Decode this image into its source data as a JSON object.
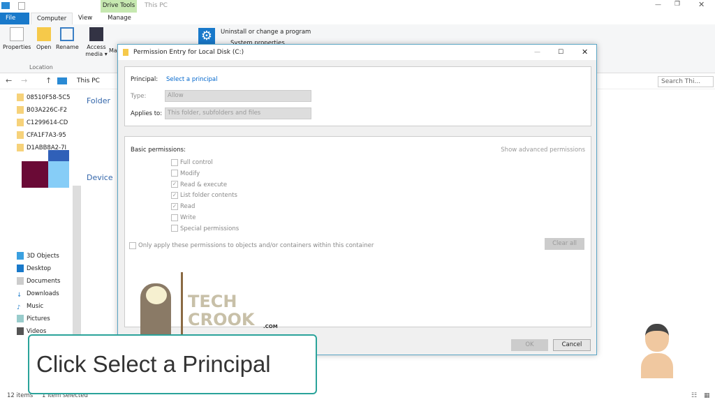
{
  "window": {
    "title": "This PC",
    "context_tab": "Drive Tools"
  },
  "tabs": [
    {
      "label": "File"
    },
    {
      "label": "Computer"
    },
    {
      "label": "View"
    },
    {
      "label": "Manage"
    }
  ],
  "ribbon": {
    "buttons": [
      {
        "label": "Properties"
      },
      {
        "label": "Open"
      },
      {
        "label": "Rename"
      },
      {
        "label": "Access media ▾"
      },
      {
        "label": "Ma"
      }
    ],
    "group_label": "Location",
    "links": [
      {
        "label": "Uninstall or change a program"
      },
      {
        "label": "System properties"
      }
    ]
  },
  "address": {
    "path": "This PC",
    "search_placeholder": "Search Thi..."
  },
  "nav": {
    "pinned": [
      {
        "label": "08510F58-5C5"
      },
      {
        "label": "B03A226C-F2"
      },
      {
        "label": "C1299614-CD"
      },
      {
        "label": "CFA1F7A3-95"
      },
      {
        "label": "D1ABB8A2-7I"
      }
    ],
    "items": [
      {
        "label": "3D Objects"
      },
      {
        "label": "Desktop"
      },
      {
        "label": "Documents"
      },
      {
        "label": "Downloads"
      },
      {
        "label": "Music"
      },
      {
        "label": "Pictures"
      },
      {
        "label": "Videos"
      }
    ]
  },
  "content": {
    "sections": [
      {
        "label": "Folder"
      },
      {
        "label": "Device"
      }
    ]
  },
  "status": {
    "items": "12 items",
    "selected": "1 item selected"
  },
  "dialog": {
    "title": "Permission Entry for Local Disk (C:)",
    "principal_label": "Principal:",
    "principal_link": "Select a principal",
    "type_label": "Type:",
    "type_value": "Allow",
    "applies_label": "Applies to:",
    "applies_value": "This folder, subfolders and files",
    "basic_label": "Basic permissions:",
    "advanced_link": "Show advanced permissions",
    "permissions": [
      {
        "label": "Full control",
        "checked": false
      },
      {
        "label": "Modify",
        "checked": false
      },
      {
        "label": "Read & execute",
        "checked": true
      },
      {
        "label": "List folder contents",
        "checked": true
      },
      {
        "label": "Read",
        "checked": true
      },
      {
        "label": "Write",
        "checked": false
      },
      {
        "label": "Special permissions",
        "checked": false
      }
    ],
    "only_apply": "Only apply these permissions to objects and/or containers within this container",
    "clear_all": "Clear all",
    "ok": "OK",
    "cancel": "Cancel"
  },
  "watermark": {
    "line1": "TECH",
    "line2": "CROOK",
    ".com": ".COM"
  },
  "caption": "Click Select a Principal",
  "colors": {
    "accent": "#1979ca",
    "link": "#0066cc",
    "caption_border": "#2aa39a",
    "drive_tools": "#c6e8b0"
  }
}
